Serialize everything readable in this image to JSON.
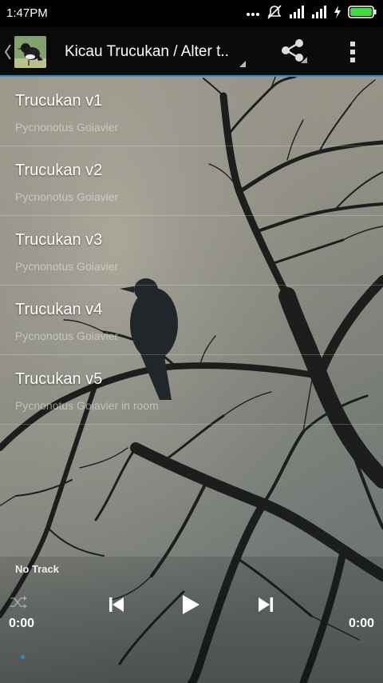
{
  "status_bar": {
    "time": "1:47PM",
    "icons": [
      "more-dots-icon",
      "silent-icon",
      "signal-icon",
      "signal-icon",
      "charging-icon",
      "battery-icon"
    ],
    "battery_color": "#3ddc3d"
  },
  "action_bar": {
    "title": "Kicau Trucukan / Alter t..",
    "icons": [
      "back-icon",
      "app-icon",
      "share-icon",
      "overflow-menu-icon"
    ],
    "accent": "#2b8fc4"
  },
  "tracks": [
    {
      "title": "Trucukan v1",
      "subtitle": "Pycnonotus Goiavier"
    },
    {
      "title": "Trucukan v2",
      "subtitle": "Pycnonotus Goiavier"
    },
    {
      "title": "Trucukan v3",
      "subtitle": "Pycnonotus Goiavier"
    },
    {
      "title": "Trucukan v4",
      "subtitle": "Pycnonotus Goiavier"
    },
    {
      "title": "Trucukan v5",
      "subtitle": "Pycnonotus Goiavier in room"
    }
  ],
  "player": {
    "track_label": "No Track",
    "current_time": "0:00",
    "total_time": "0:00",
    "controls": [
      "shuffle-icon",
      "previous-icon",
      "play-icon",
      "next-icon"
    ],
    "progress": 0
  }
}
